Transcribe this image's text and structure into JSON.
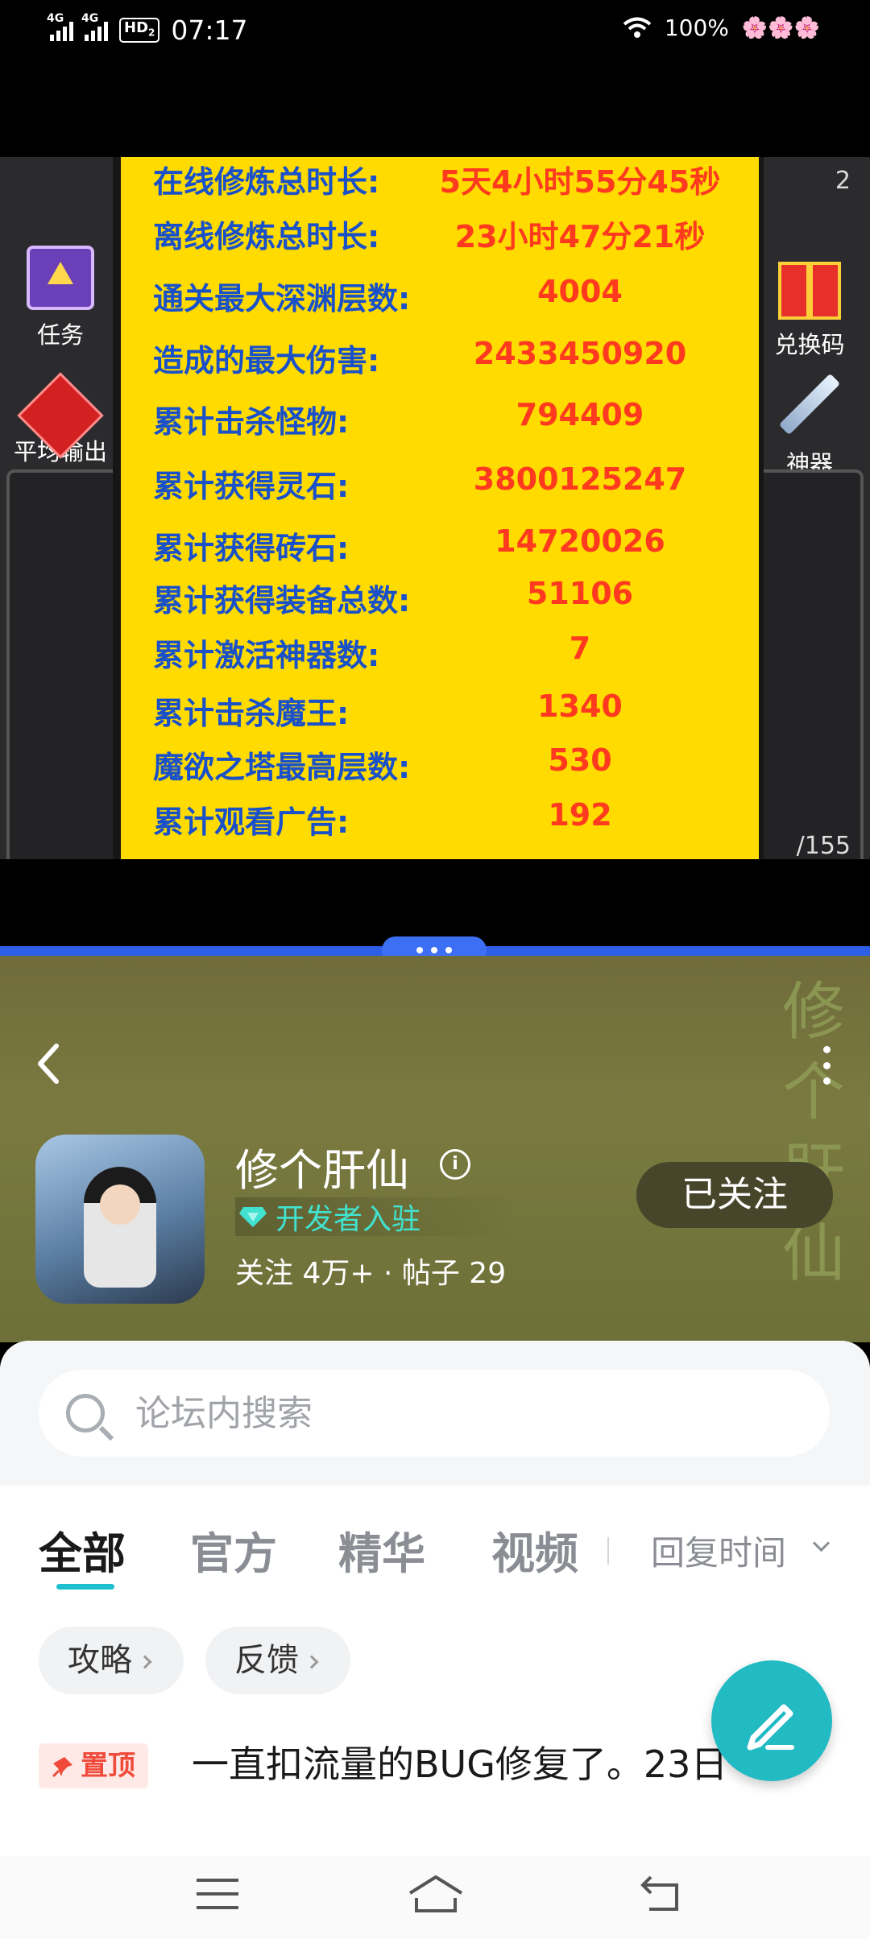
{
  "status_bar": {
    "network1": "4G",
    "network2": "4G",
    "hd": "HD",
    "hd_sub": "2",
    "time": "07:17",
    "battery": "100%",
    "flowers": "🌸🌸🌸"
  },
  "game": {
    "left_items": [
      {
        "label": "任务",
        "icon": "spellbook-icon"
      },
      {
        "label": "平均输出\n你的肝",
        "icon": "red-gem-icon"
      }
    ],
    "right_items": [
      {
        "label": "兑换码",
        "icon": "gift-box-icon"
      },
      {
        "label": "神器",
        "icon": "sword-icon"
      }
    ],
    "right_partial_top": "2",
    "right_partial_bottom": "/155",
    "stats": [
      {
        "label": "在线修炼总时长:",
        "value": "5天4小时55分45秒"
      },
      {
        "label": "离线修炼总时长:",
        "value": "23小时47分21秒"
      },
      {
        "label": "通关最大深渊层数:",
        "value": "4004"
      },
      {
        "label": "造成的最大伤害:",
        "value": "2433450920"
      },
      {
        "label": "累计击杀怪物:",
        "value": "794409"
      },
      {
        "label": "累计获得灵石:",
        "value": "3800125247"
      },
      {
        "label": "累计获得砖石:",
        "value": "14720026"
      },
      {
        "label": "累计获得装备总数:",
        "value": "51106"
      },
      {
        "label": "累计激活神器数:",
        "value": "7"
      },
      {
        "label": "累计击杀魔王:",
        "value": "1340"
      },
      {
        "label": "魔欲之塔最高层数:",
        "value": "530"
      },
      {
        "label": "累计观看广告:",
        "value": "192"
      }
    ],
    "colors": {
      "panel": "#ffdb00",
      "label": "#1a51c9",
      "value": "#ff3a1f"
    }
  },
  "forum": {
    "game_name": "修个肝仙",
    "hero_deco": "修个肝仙",
    "developer_badge": "开发者入驻",
    "meta": "关注 4万+ · 帖子 29",
    "follow_button": "已关注",
    "search_placeholder": "论坛内搜索",
    "tabs": [
      "全部",
      "官方",
      "精华",
      "视频"
    ],
    "active_tab": "全部",
    "sort_label": "回复时间",
    "chips": [
      "攻略",
      "反馈"
    ],
    "pinned_badge": "置顶",
    "post_title": "一直扣流量的BUG修复了。23日",
    "accent": "#22bac3"
  }
}
